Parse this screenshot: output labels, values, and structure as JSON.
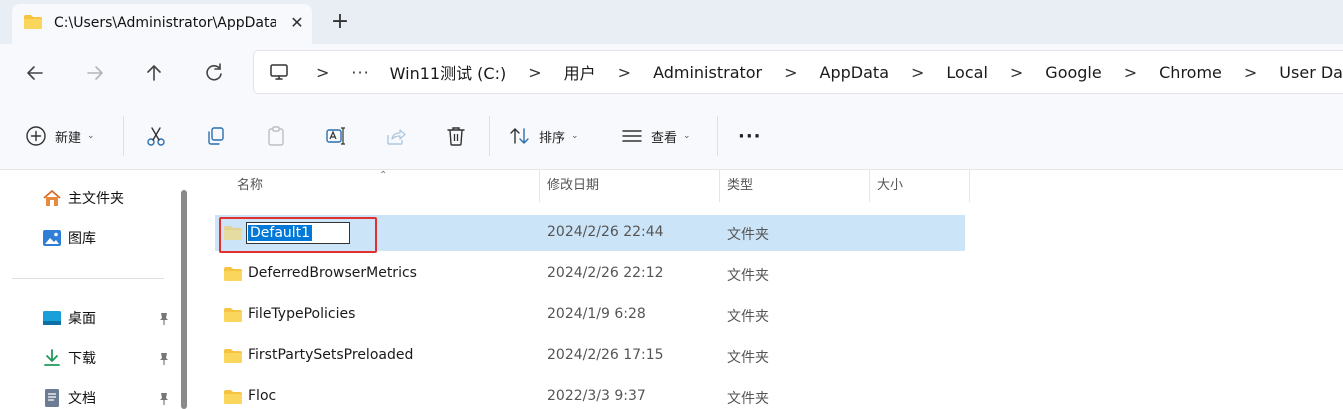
{
  "tab": {
    "title": "C:\\Users\\Administrator\\AppData",
    "close_symbol": "✕",
    "new_tab_symbol": "+"
  },
  "nav": {
    "back_icon": "arrow-left-icon",
    "forward_icon": "arrow-right-icon",
    "up_icon": "arrow-up-icon",
    "refresh_icon": "refresh-icon"
  },
  "address": {
    "more": "···",
    "crumbs": [
      "Win11测试 (C:)",
      "用户",
      "Administrator",
      "AppData",
      "Local",
      "Google",
      "Chrome",
      "User Data"
    ],
    "separator": ">"
  },
  "toolbar": {
    "new_label": "新建",
    "sort_label": "排序",
    "view_label": "查看",
    "more_label": "···"
  },
  "sidebar": {
    "items": [
      {
        "label": "主文件夹",
        "icon": "home-icon"
      },
      {
        "label": "图库",
        "icon": "gallery-icon"
      },
      {
        "label": "桌面",
        "icon": "desktop-icon",
        "pinned": true
      },
      {
        "label": "下载",
        "icon": "download-icon",
        "pinned": true
      },
      {
        "label": "文档",
        "icon": "document-icon",
        "pinned": true
      }
    ]
  },
  "columns": {
    "name": "名称",
    "date": "修改日期",
    "type": "类型",
    "size": "大小"
  },
  "files": [
    {
      "name": "Default1",
      "date": "2024/2/26 22:44",
      "type": "文件夹",
      "renaming": true,
      "selected": true
    },
    {
      "name": "DeferredBrowserMetrics",
      "date": "2024/2/26 22:12",
      "type": "文件夹"
    },
    {
      "name": "FileTypePolicies",
      "date": "2024/1/9 6:28",
      "type": "文件夹"
    },
    {
      "name": "FirstPartySetsPreloaded",
      "date": "2024/2/26 17:15",
      "type": "文件夹"
    },
    {
      "name": "Floc",
      "date": "2022/3/3 9:37",
      "type": "文件夹"
    }
  ],
  "colors": {
    "folder": "#f6c343",
    "selection": "#cce4f7",
    "rename_highlight": "#0078d7",
    "annotation_red": "#e03030"
  }
}
